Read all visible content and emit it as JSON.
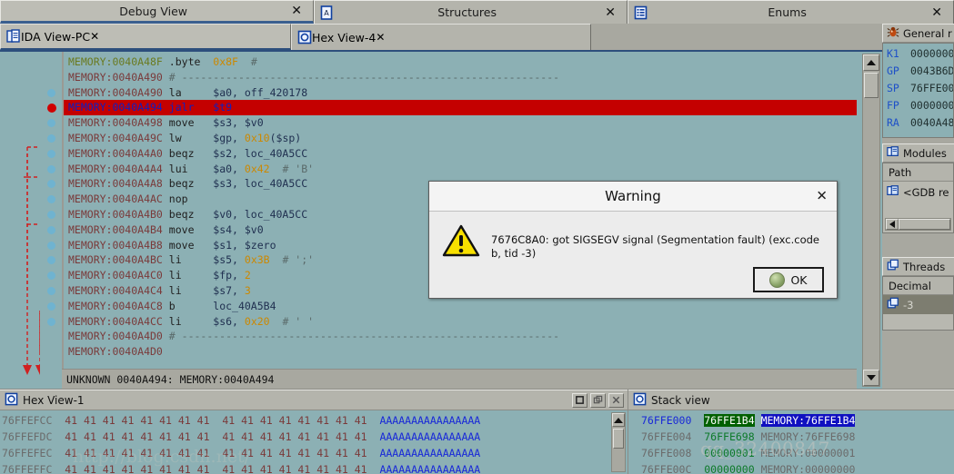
{
  "top_tabs": [
    {
      "label": "Debug View",
      "icon": "debug-view-icon",
      "close": "✕",
      "active": true
    },
    {
      "label": "Structures",
      "icon": "structures-icon",
      "close": "✕",
      "active": false
    },
    {
      "label": "Enums",
      "icon": "enums-icon",
      "close": "✕",
      "active": false
    }
  ],
  "sub_tabs": [
    {
      "label": "IDA View-PC",
      "icon": "ida-view-icon",
      "close": "✕",
      "active": true
    },
    {
      "label": "Hex View-4",
      "icon": "hex-view-icon",
      "close": "✕",
      "active": false
    }
  ],
  "disassembly": {
    "lines": [
      {
        "addr": "MEMORY:0040A48F",
        "mnemonic": ".byte",
        "operands": "0x8F",
        "comment": "#",
        "addr_color": "green",
        "dot": false,
        "bp": false,
        "hl": false
      },
      {
        "addr": "MEMORY:0040A490",
        "mnemonic": "",
        "operands": "",
        "comment": "# ------------------------------------------------------------",
        "addr_color": "normal",
        "dot": false,
        "bp": false,
        "hl": false
      },
      {
        "addr": "MEMORY:0040A490",
        "mnemonic": "la",
        "operands": "$a0, off_420178",
        "comment": "",
        "addr_color": "normal",
        "dot": true,
        "bp": false,
        "hl": false
      },
      {
        "addr": "MEMORY:0040A494",
        "mnemonic": "jalr",
        "operands": "$t9",
        "comment": "",
        "addr_color": "normal",
        "dot": true,
        "bp": true,
        "hl": true
      },
      {
        "addr": "MEMORY:0040A498",
        "mnemonic": "move",
        "operands": "$s3, $v0",
        "comment": "",
        "addr_color": "normal",
        "dot": true,
        "bp": false,
        "hl": false
      },
      {
        "addr": "MEMORY:0040A49C",
        "mnemonic": "lw",
        "operands": "$gp, 0x10($sp)",
        "comment": "",
        "addr_color": "normal",
        "dot": true,
        "bp": false,
        "hl": false
      },
      {
        "addr": "MEMORY:0040A4A0",
        "mnemonic": "beqz",
        "operands": "$s2, loc_40A5CC",
        "comment": "",
        "addr_color": "normal",
        "dot": true,
        "bp": false,
        "hl": false
      },
      {
        "addr": "MEMORY:0040A4A4",
        "mnemonic": "lui",
        "operands": "$a0, 0x42",
        "comment": "# 'B'",
        "addr_color": "normal",
        "dot": true,
        "bp": false,
        "hl": false
      },
      {
        "addr": "MEMORY:0040A4A8",
        "mnemonic": "beqz",
        "operands": "$s3, loc_40A5CC",
        "comment": "",
        "addr_color": "normal",
        "dot": true,
        "bp": false,
        "hl": false
      },
      {
        "addr": "MEMORY:0040A4AC",
        "mnemonic": "nop",
        "operands": "",
        "comment": "",
        "addr_color": "normal",
        "dot": true,
        "bp": false,
        "hl": false
      },
      {
        "addr": "MEMORY:0040A4B0",
        "mnemonic": "beqz",
        "operands": "$v0, loc_40A5CC",
        "comment": "",
        "addr_color": "normal",
        "dot": true,
        "bp": false,
        "hl": false
      },
      {
        "addr": "MEMORY:0040A4B4",
        "mnemonic": "move",
        "operands": "$s4, $v0",
        "comment": "",
        "addr_color": "normal",
        "dot": true,
        "bp": false,
        "hl": false
      },
      {
        "addr": "MEMORY:0040A4B8",
        "mnemonic": "move",
        "operands": "$s1, $zero",
        "comment": "",
        "addr_color": "normal",
        "dot": true,
        "bp": false,
        "hl": false
      },
      {
        "addr": "MEMORY:0040A4BC",
        "mnemonic": "li",
        "operands": "$s5, 0x3B",
        "comment": "# ';'",
        "addr_color": "normal",
        "dot": true,
        "bp": false,
        "hl": false
      },
      {
        "addr": "MEMORY:0040A4C0",
        "mnemonic": "li",
        "operands": "$fp, 2",
        "comment": "",
        "addr_color": "normal",
        "dot": true,
        "bp": false,
        "hl": false
      },
      {
        "addr": "MEMORY:0040A4C4",
        "mnemonic": "li",
        "operands": "$s7, 3",
        "comment": "",
        "addr_color": "normal",
        "dot": true,
        "bp": false,
        "hl": false
      },
      {
        "addr": "MEMORY:0040A4C8",
        "mnemonic": "b",
        "operands": "loc_40A5B4",
        "comment": "",
        "addr_color": "normal",
        "dot": true,
        "bp": false,
        "hl": false
      },
      {
        "addr": "MEMORY:0040A4CC",
        "mnemonic": "li",
        "operands": "$s6, 0x20",
        "comment": "# ' '",
        "addr_color": "normal",
        "dot": true,
        "bp": false,
        "hl": false
      },
      {
        "addr": "MEMORY:0040A4D0",
        "mnemonic": "",
        "operands": "",
        "comment": "# ------------------------------------------------------------",
        "addr_color": "normal",
        "dot": false,
        "bp": false,
        "hl": false
      },
      {
        "addr": "MEMORY:0040A4D0",
        "mnemonic": "",
        "operands": "",
        "comment": "",
        "addr_color": "normal",
        "dot": false,
        "bp": false,
        "hl": false
      }
    ],
    "status": "UNKNOWN 0040A494: MEMORY:0040A494"
  },
  "sidebar": {
    "registers_panel": {
      "title": "General r",
      "icon": "bug-icon"
    },
    "registers": [
      {
        "name": "K1",
        "value": "0000000"
      },
      {
        "name": "GP",
        "value": "0043B6D"
      },
      {
        "name": "SP",
        "value": "76FFE00"
      },
      {
        "name": "FP",
        "value": "0000000"
      },
      {
        "name": "RA",
        "value": "0040A48"
      }
    ],
    "modules_panel": {
      "title": "Modules",
      "icon": "modules-icon"
    },
    "modules_column": "Path",
    "modules": [
      {
        "label": "<GDB re",
        "icon": "module-icon"
      }
    ],
    "threads_panel": {
      "title": "Threads",
      "icon": "threads-icon"
    },
    "threads_column": "Decimal",
    "threads": [
      {
        "label": "-3",
        "icon": "thread-icon"
      }
    ]
  },
  "hex_view": {
    "title": "Hex View-1",
    "icon": "hex-view-icon",
    "rows": [
      {
        "offset": "76FFEFCC",
        "bytes": "41 41 41 41 41 41 41 41  41 41 41 41 41 41 41 41",
        "ascii": "AAAAAAAAAAAAAAAA"
      },
      {
        "offset": "76FFEFDC",
        "bytes": "41 41 41 41 41 41 41 41  41 41 41 41 41 41 41 41",
        "ascii": "AAAAAAAAAAAAAAAA"
      },
      {
        "offset": "76FFEFEC",
        "bytes": "41 41 41 41 41 41 41 41  41 41 41 41 41 41 41 41",
        "ascii": "AAAAAAAAAAAAAAAA"
      },
      {
        "offset": "76FFEFFC",
        "bytes": "41 41 41 41 41 41 41 41  41 41 41 41 41 41 41 41",
        "ascii": "AAAAAAAAAAAAAAAA"
      }
    ],
    "buttons": [
      "restore-button",
      "maximize-button",
      "close-button"
    ]
  },
  "stack_view": {
    "title": "Stack view",
    "icon": "stack-view-icon",
    "rows": [
      {
        "addr": "76FFE000",
        "value": "76FFE1B4",
        "ref": "MEMORY:76FFE1B4",
        "selected": true
      },
      {
        "addr": "76FFE004",
        "value": "76FFE698",
        "ref": "MEMORY:76FFE698",
        "selected": false
      },
      {
        "addr": "76FFE008",
        "value": "00000001",
        "ref": "MEMORY:00000001",
        "selected": false
      },
      {
        "addr": "76FFE00C",
        "value": "00000000",
        "ref": "MEMORY:00000000",
        "selected": false
      }
    ]
  },
  "dialog": {
    "title": "Warning",
    "close": "✕",
    "message": "7676C8A0: got SIGSEGV signal (Segmentation fault) (exc.code b, tid -3)",
    "ok_label": "OK",
    "icon": "warning-triangle-icon"
  },
  "watermark": {
    "line1": "qq_32400847",
    "line2": "http://blog.csdn.net/"
  },
  "colors": {
    "disasm_bg": "#8cb0b4",
    "chrome": "#a8a8a0",
    "highlight_red": "#c40000",
    "breakpoint_red": "#d00000",
    "accent_blue": "#2d4f7c"
  }
}
